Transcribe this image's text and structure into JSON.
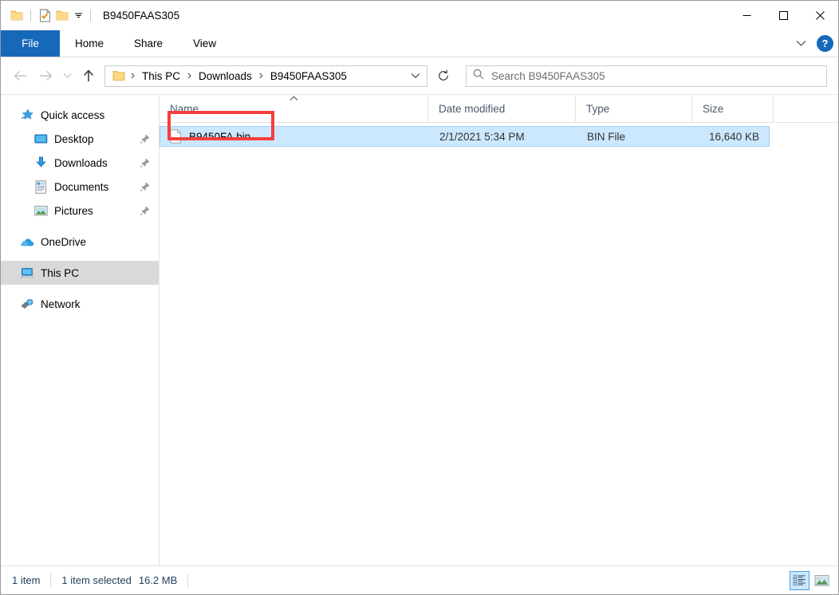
{
  "window": {
    "title": "B9450FAAS305",
    "quick_access_toolbar": [
      {
        "name": "folder-icon",
        "label": "Folder"
      },
      {
        "name": "properties-icon",
        "label": "Properties"
      },
      {
        "name": "new-folder-icon",
        "label": "New folder"
      },
      {
        "name": "chevron-down-icon",
        "label": "Customize Quick Access Toolbar"
      }
    ],
    "controls": {
      "minimize": "Minimize",
      "maximize": "Maximize",
      "close": "Close"
    }
  },
  "ribbon": {
    "tabs": [
      {
        "label": "File",
        "active": true
      },
      {
        "label": "Home",
        "active": false
      },
      {
        "label": "Share",
        "active": false
      },
      {
        "label": "View",
        "active": false
      }
    ],
    "expand_label": "Expand the Ribbon",
    "help_label": "?"
  },
  "navigation": {
    "back": "Back",
    "forward": "Forward",
    "recent": "Recent locations",
    "up": "Up",
    "refresh": "Refresh",
    "breadcrumb": [
      "This PC",
      "Downloads",
      "B9450FAAS305"
    ],
    "breadcrumb_separator": "›",
    "dropdown": "Previous locations"
  },
  "search": {
    "placeholder": "Search B9450FAAS305",
    "value": "",
    "icon": "search-icon"
  },
  "sidebar": {
    "items": [
      {
        "label": "Quick access",
        "icon": "quick-access-star-icon",
        "level": 0,
        "pinned": false,
        "selected": false
      },
      {
        "label": "Desktop",
        "icon": "desktop-icon",
        "level": 1,
        "pinned": true,
        "selected": false
      },
      {
        "label": "Downloads",
        "icon": "downloads-icon",
        "level": 1,
        "pinned": true,
        "selected": false
      },
      {
        "label": "Documents",
        "icon": "documents-icon",
        "level": 1,
        "pinned": true,
        "selected": false
      },
      {
        "label": "Pictures",
        "icon": "pictures-icon",
        "level": 1,
        "pinned": true,
        "selected": false
      },
      {
        "label": "OneDrive",
        "icon": "onedrive-cloud-icon",
        "level": 0,
        "pinned": false,
        "selected": false
      },
      {
        "label": "This PC",
        "icon": "this-pc-icon",
        "level": 0,
        "pinned": false,
        "selected": true
      },
      {
        "label": "Network",
        "icon": "network-icon",
        "level": 0,
        "pinned": false,
        "selected": false
      }
    ]
  },
  "filelist": {
    "columns": [
      {
        "key": "name",
        "label": "Name",
        "sorted": "asc"
      },
      {
        "key": "date",
        "label": "Date modified",
        "sorted": ""
      },
      {
        "key": "type",
        "label": "Type",
        "sorted": ""
      },
      {
        "key": "size",
        "label": "Size",
        "sorted": ""
      }
    ],
    "rows": [
      {
        "name": "B9450FA.bin",
        "date": "2/1/2021 5:34 PM",
        "type": "BIN File",
        "size": "16,640 KB",
        "icon": "generic-file-icon",
        "selected": true,
        "highlighted": true
      }
    ]
  },
  "statusbar": {
    "item_count": "1 item",
    "selection": "1 item selected",
    "selection_size": "16.2 MB",
    "views": [
      {
        "name": "details-view-button",
        "label": "Details view",
        "active": true
      },
      {
        "name": "large-icons-view-button",
        "label": "Large icons view",
        "active": false
      }
    ]
  },
  "annotation": {
    "color": "#f43f3f",
    "target": "B9450FA.bin"
  }
}
